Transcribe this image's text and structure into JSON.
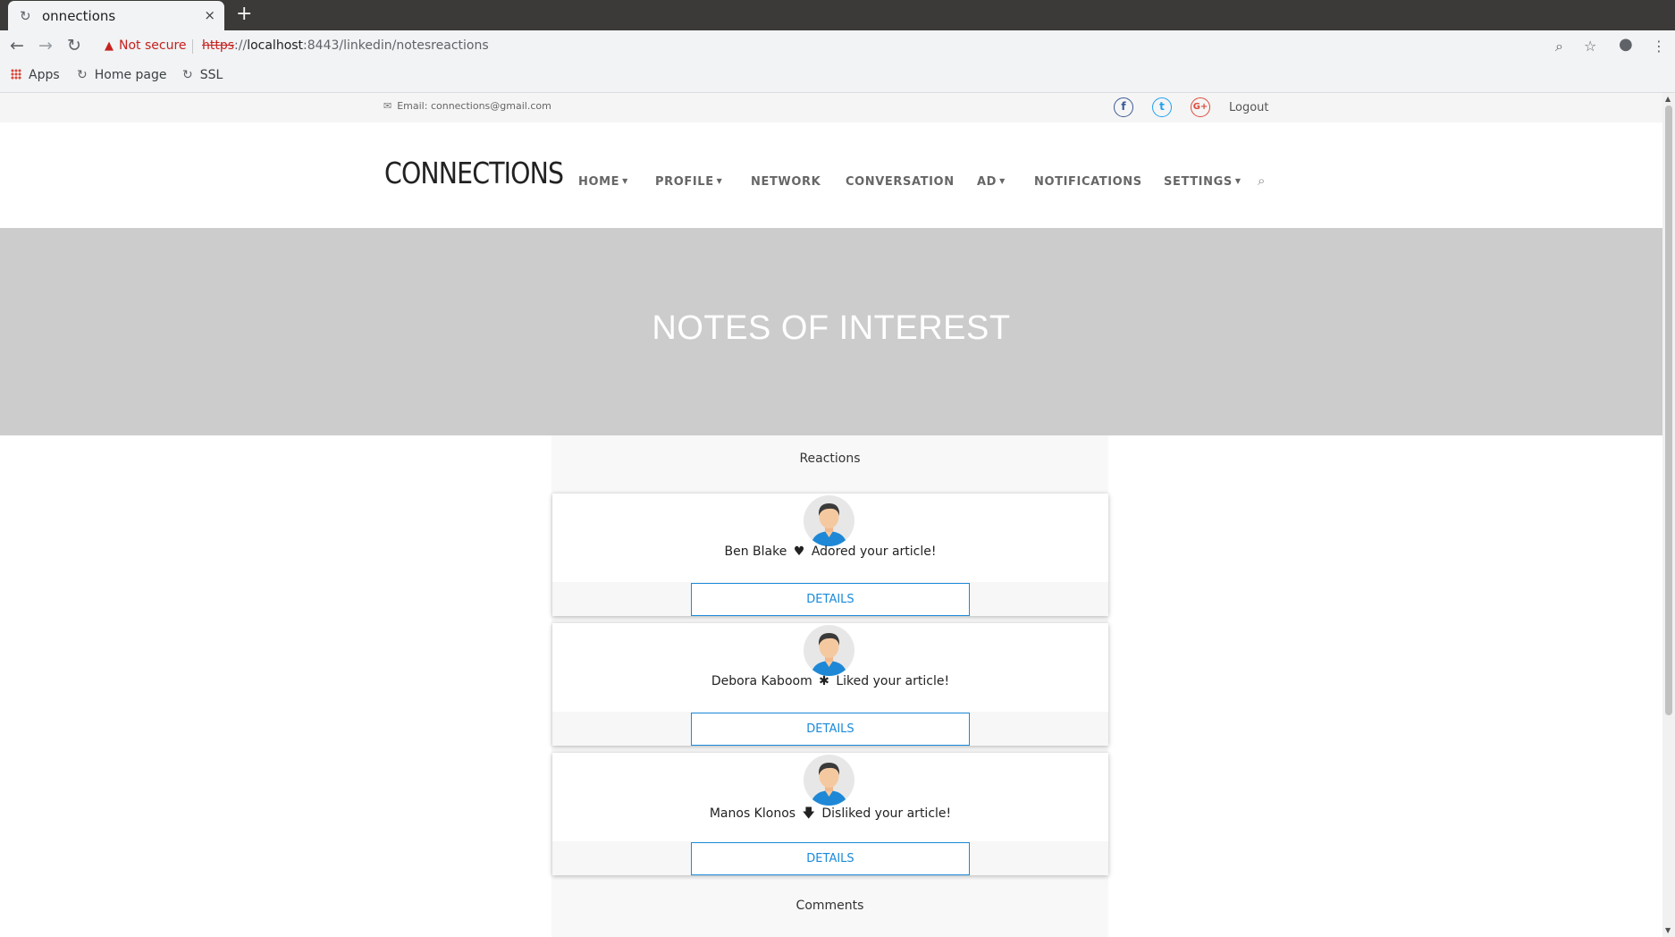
{
  "browser": {
    "tab_title": "onnections",
    "tab_close": "×",
    "new_tab": "+",
    "security_label": "Not secure",
    "url_scheme": "https",
    "url_rest": "://",
    "url_host": "localhost",
    "url_path": ":8443/linkedin/notesreactions",
    "bookmarks": [
      {
        "label": "Apps"
      },
      {
        "label": "Home page"
      },
      {
        "label": "SSL"
      }
    ]
  },
  "topbar": {
    "email": "Email: connections@gmail.com",
    "facebook": "f",
    "twitter": "t",
    "googleplus": "G+",
    "logout": "Logout"
  },
  "nav": {
    "logo": "CONNECTIONS",
    "items": [
      {
        "label": "HOME",
        "dropdown": true
      },
      {
        "label": "PROFILE",
        "dropdown": true
      },
      {
        "label": "NETWORK",
        "dropdown": false
      },
      {
        "label": "CONVERSATION",
        "dropdown": false
      },
      {
        "label": "AD",
        "dropdown": true
      },
      {
        "label": "NOTIFICATIONS",
        "dropdown": false
      },
      {
        "label": "SETTINGS",
        "dropdown": true
      }
    ]
  },
  "hero": {
    "title": "NOTES OF INTEREST"
  },
  "reactions": {
    "heading": "Reactions",
    "items": [
      {
        "name": "Ben Blake",
        "icon": "heart-icon",
        "symbol": "♥",
        "text": "Adored your article!",
        "button": "DETAILS"
      },
      {
        "name": "Debora Kaboom",
        "icon": "asterisk-icon",
        "symbol": "✱",
        "text": "Liked your article!",
        "button": "DETAILS"
      },
      {
        "name": "Manos Klonos",
        "icon": "arrow-down-icon",
        "symbol": "🡇",
        "text": "Disliked your article!",
        "button": "DETAILS"
      }
    ]
  },
  "comments": {
    "heading": "Comments"
  },
  "colors": {
    "accent": "#1a8ad9",
    "hero_bg": "#cccccc",
    "facebook": "#3b5998",
    "twitter": "#1da1f2",
    "googleplus": "#dd4b39"
  }
}
